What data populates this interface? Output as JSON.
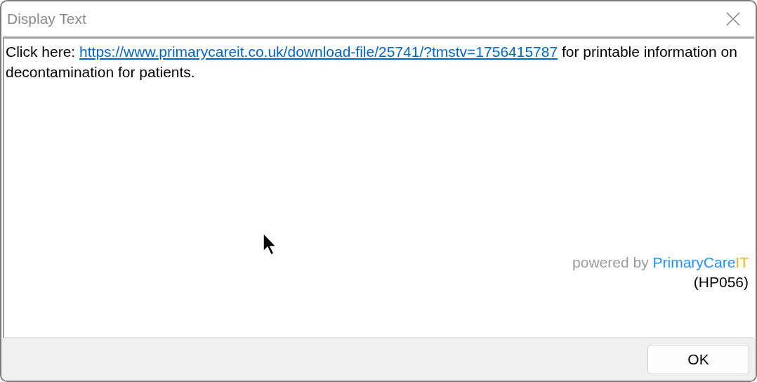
{
  "window": {
    "title": "Display Text"
  },
  "message": {
    "prefix": "Click here:",
    "link": "https://www.primarycareit.co.uk/download-file/25741/?tmstv=1756415787",
    "suffix": "for printable information on decontamination for patients."
  },
  "powered_by": {
    "prefix": "powered by",
    "brand": "PrimaryCare",
    "brand_suffix": "IT"
  },
  "code": "(HP056)",
  "buttons": [
    "OK"
  ]
}
